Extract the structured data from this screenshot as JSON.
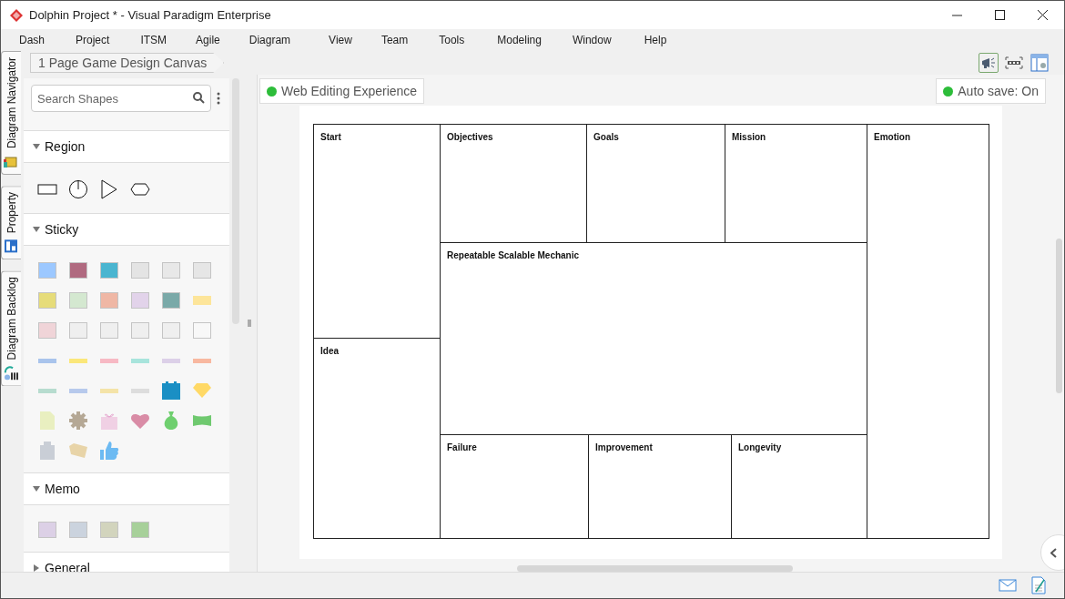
{
  "window": {
    "title": "Dolphin Project * - Visual Paradigm Enterprise"
  },
  "menu": [
    "Dash",
    "Project",
    "ITSM",
    "Agile",
    "Diagram",
    "View",
    "Team",
    "Tools",
    "Modeling",
    "Window",
    "Help"
  ],
  "side_tabs": [
    {
      "label": "Diagram Navigator",
      "selected": false
    },
    {
      "label": "Property",
      "selected": false
    },
    {
      "label": "Diagram Backlog",
      "selected": false
    }
  ],
  "breadcrumb": "1 Page Game Design Canvas",
  "search": {
    "placeholder": "Search Shapes"
  },
  "palette": [
    {
      "title": "Region",
      "expanded": true
    },
    {
      "title": "Sticky",
      "expanded": true
    },
    {
      "title": "Memo",
      "expanded": true
    },
    {
      "title": "General",
      "expanded": false
    }
  ],
  "status_pills": [
    {
      "label": "Web Editing Experience",
      "color": "#2dbd3a"
    },
    {
      "label": "Auto save: On",
      "color": "#2dbd3a"
    }
  ],
  "canvas": {
    "cells": [
      {
        "label": "Start"
      },
      {
        "label": "Idea"
      },
      {
        "label": "Objectives"
      },
      {
        "label": "Goals"
      },
      {
        "label": "Mission"
      },
      {
        "label": "Emotion"
      },
      {
        "label": "Repeatable Scalable Mechanic"
      },
      {
        "label": "Failure"
      },
      {
        "label": "Improvement"
      },
      {
        "label": "Longevity"
      }
    ]
  }
}
